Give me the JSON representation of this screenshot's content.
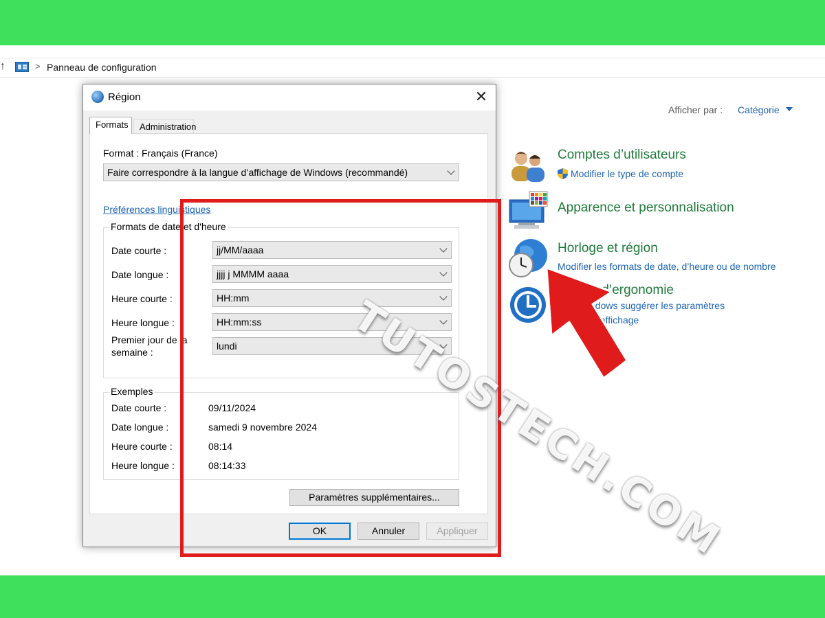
{
  "colors": {
    "band_green": "#3fe05c",
    "category_title": "#1f7a3b",
    "link_blue": "#1d64b4",
    "highlight_red": "#e01b1b",
    "default_button_border": "#0078d7"
  },
  "control_panel": {
    "addressbar": {
      "up_icon": "up-arrow-icon",
      "path_icon": "control-panel-icon",
      "separator": ">",
      "path": "Panneau de configuration"
    },
    "view_by": {
      "label": "Afficher par :",
      "value": "Catégorie"
    },
    "categories": [
      {
        "title": "Comptes d’utilisateurs",
        "icon": "users-icon",
        "links": [
          {
            "text": "Modifier le type de compte",
            "icon": "uac-shield-icon"
          }
        ]
      },
      {
        "title": "Apparence et personnalisation",
        "icon": "monitor-palette-icon",
        "links": []
      },
      {
        "title": "Horloge et région",
        "icon": "clock-globe-icon",
        "links": [
          {
            "text": "Modifier les formats de date, d’heure ou de nombre"
          }
        ]
      },
      {
        "title": "tions d’ergonomie",
        "icon": "ease-of-access-icon",
        "links": [
          {
            "text": "ndows suggérer les paramètres"
          },
          {
            "text": "r l’affichage"
          }
        ]
      }
    ]
  },
  "dialog": {
    "title": "Région",
    "icon": "globe-icon",
    "close_icon": "close-icon",
    "tabs": [
      {
        "label": "Formats",
        "active": true
      },
      {
        "label": "Administration",
        "active": false
      }
    ],
    "format_label": "Format : Français (France)",
    "format_value": "Faire correspondre à la langue d’affichage de Windows (recommandé)",
    "language_prefs_link": "Préférences linguistiques",
    "date_time_group": {
      "title": "Formats de date et d'heure",
      "rows": [
        {
          "label": "Date courte :",
          "value": "jj/MM/aaaa"
        },
        {
          "label": "Date longue :",
          "value": "jjjj j MMMM aaaa"
        },
        {
          "label": "Heure courte :",
          "value": "HH:mm"
        },
        {
          "label": "Heure longue :",
          "value": "HH:mm:ss"
        },
        {
          "label": "Premier jour de la semaine :",
          "value": "lundi"
        }
      ]
    },
    "examples_group": {
      "title": "Exemples",
      "rows": [
        {
          "label": "Date courte :",
          "value": "09/11/2024"
        },
        {
          "label": "Date longue :",
          "value": "samedi 9 novembre 2024"
        },
        {
          "label": "Heure courte :",
          "value": "08:14"
        },
        {
          "label": "Heure longue :",
          "value": "08:14:33"
        }
      ]
    },
    "additional_settings_button": "Paramètres supplémentaires...",
    "buttons": {
      "ok": "OK",
      "cancel": "Annuler",
      "apply": "Appliquer"
    }
  },
  "watermark": "TUTOSTECH.COM"
}
